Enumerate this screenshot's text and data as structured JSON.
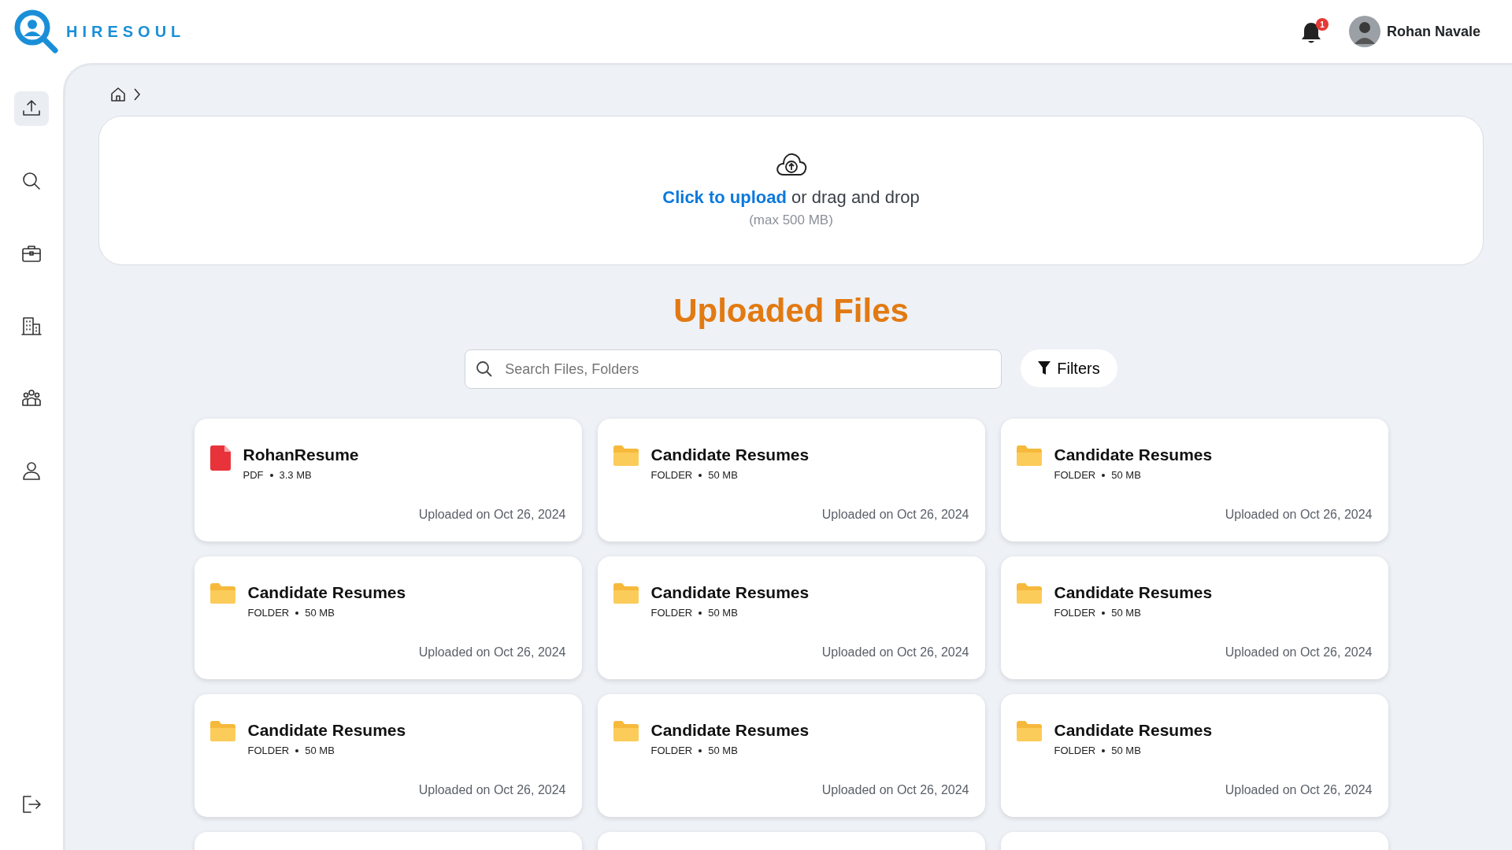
{
  "brand": {
    "name": "HIRESOUL"
  },
  "header": {
    "notification_count": "1",
    "user_name": "Rohan Navale"
  },
  "sidebar": {
    "items": [
      {
        "selected": true
      },
      {
        "selected": false
      },
      {
        "selected": false
      },
      {
        "selected": false
      },
      {
        "selected": false
      },
      {
        "selected": false
      }
    ]
  },
  "upload": {
    "link": "Click to upload",
    "text": "or drag and drop",
    "hint": "(max 500 MB)"
  },
  "title": "Uploaded Files",
  "search": {
    "placeholder": "Search Files, Folders"
  },
  "filters_button": "Filters",
  "files": [
    {
      "kind": "pdf",
      "name": "RohanResume",
      "type": "PDF",
      "size": "3.3 MB",
      "date": "Uploaded on Oct 26, 2024"
    },
    {
      "kind": "folder",
      "name": "Candidate Resumes",
      "type": "FOLDER",
      "size": "50 MB",
      "date": "Uploaded on Oct 26, 2024"
    },
    {
      "kind": "folder",
      "name": "Candidate Resumes",
      "type": "FOLDER",
      "size": "50 MB",
      "date": "Uploaded on Oct 26, 2024"
    },
    {
      "kind": "folder",
      "name": "Candidate Resumes",
      "type": "FOLDER",
      "size": "50 MB",
      "date": "Uploaded on Oct 26, 2024"
    },
    {
      "kind": "folder",
      "name": "Candidate Resumes",
      "type": "FOLDER",
      "size": "50 MB",
      "date": "Uploaded on Oct 26, 2024"
    },
    {
      "kind": "folder",
      "name": "Candidate Resumes",
      "type": "FOLDER",
      "size": "50 MB",
      "date": "Uploaded on Oct 26, 2024"
    },
    {
      "kind": "folder",
      "name": "Candidate Resumes",
      "type": "FOLDER",
      "size": "50 MB",
      "date": "Uploaded on Oct 26, 2024"
    },
    {
      "kind": "folder",
      "name": "Candidate Resumes",
      "type": "FOLDER",
      "size": "50 MB",
      "date": "Uploaded on Oct 26, 2024"
    },
    {
      "kind": "folder",
      "name": "Candidate Resumes",
      "type": "FOLDER",
      "size": "50 MB",
      "date": "Uploaded on Oct 26, 2024"
    },
    {
      "kind": "partial"
    },
    {
      "kind": "partial"
    },
    {
      "kind": "partial"
    }
  ]
}
